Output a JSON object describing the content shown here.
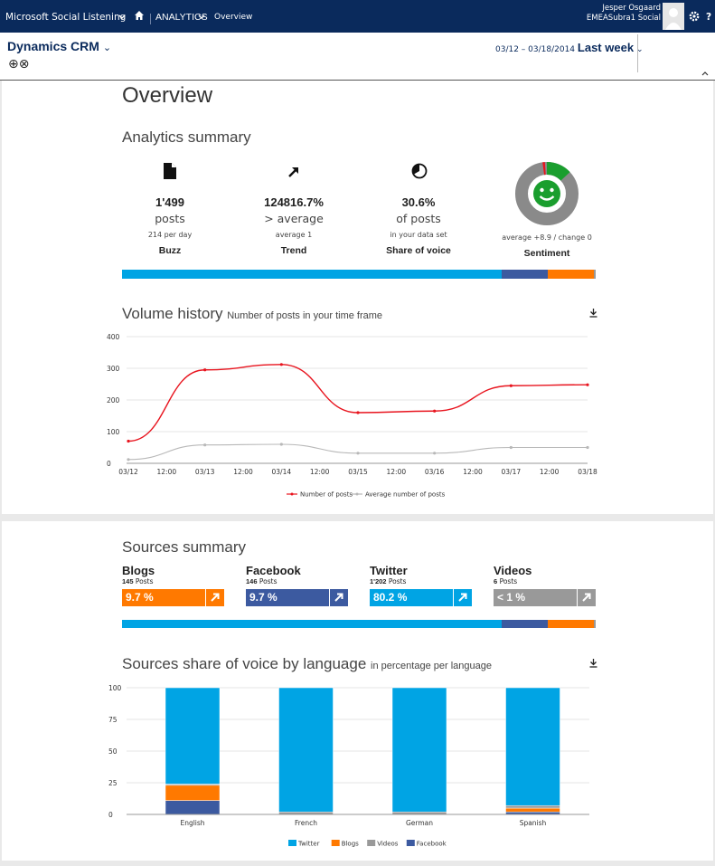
{
  "topbar": {
    "app_title": "Microsoft Social Listening",
    "section": "ANALYTICS",
    "page": "Overview",
    "user_name": "Jesper Osgaard",
    "user_org": "EMEASubra1 Social"
  },
  "context": {
    "entity": "Dynamics CRM",
    "date_range": "03/12 – 03/18/2014",
    "period": "Last week"
  },
  "page_title": "Overview",
  "analytics_summary": {
    "heading": "Analytics summary",
    "stats": [
      {
        "icon": "document-icon",
        "value": "1'499",
        "unit": "posts",
        "sub": "214 per day",
        "label": "Buzz"
      },
      {
        "icon": "trend-arrow-icon",
        "value": "124816.7%",
        "unit": "> average",
        "sub": "average 1",
        "label": "Trend"
      },
      {
        "icon": "share-pie-icon",
        "value": "30.6%",
        "unit": "of posts",
        "sub": "in your data set",
        "label": "Share of voice"
      },
      {
        "icon": "smiley-icon",
        "value": "",
        "unit": "",
        "sub": "average +8.9 / change 0",
        "label": "Sentiment"
      }
    ],
    "sentiment_shares": {
      "positive": 0.13,
      "neutral": 0.85,
      "negative": 0.02
    }
  },
  "share_bar": [
    {
      "name": "Twitter",
      "share": 0.802,
      "color": "#00a4e4"
    },
    {
      "name": "Facebook",
      "share": 0.097,
      "color": "#3c5aa0"
    },
    {
      "name": "Blogs",
      "share": 0.097,
      "color": "#ff7900"
    },
    {
      "name": "Videos",
      "share": 0.004,
      "color": "#999999"
    }
  ],
  "volume_history": {
    "heading": "Volume history",
    "subheading": "Number of posts in your time frame",
    "download_icon": "download-icon"
  },
  "sources_summary": {
    "heading": "Sources summary",
    "sources": [
      {
        "name": "Blogs",
        "count": "145",
        "count_label": "Posts",
        "share": "9.7 %",
        "color": "#ff7900"
      },
      {
        "name": "Facebook",
        "count": "146",
        "count_label": "Posts",
        "share": "9.7 %",
        "color": "#3c5aa0"
      },
      {
        "name": "Twitter",
        "count": "1'202",
        "count_label": "Posts",
        "share": "80.2 %",
        "color": "#00a4e4"
      },
      {
        "name": "Videos",
        "count": "6",
        "count_label": "Posts",
        "share": "< 1 %",
        "color": "#999999"
      }
    ]
  },
  "language_share": {
    "heading": "Sources share of voice by language",
    "subheading": "in percentage per language",
    "download_icon": "download-icon"
  },
  "chart_data": [
    {
      "type": "line",
      "title": "Volume history",
      "subtitle": "Number of posts in your time frame",
      "x": [
        "03/12",
        "03/13",
        "03/14",
        "03/15",
        "03/16",
        "03/17",
        "03/18"
      ],
      "x_tick_labels": [
        "03/12",
        "12:00",
        "03/13",
        "12:00",
        "03/14",
        "12:00",
        "03/15",
        "12:00",
        "03/16",
        "12:00",
        "03/17",
        "12:00",
        "03/18"
      ],
      "y_ticks": [
        0,
        100,
        200,
        300,
        400
      ],
      "ylim": [
        0,
        400
      ],
      "grid": true,
      "legend": "bottom",
      "series": [
        {
          "name": "Number of posts",
          "color": "#e8141e",
          "values": [
            70,
            295,
            312,
            160,
            165,
            245,
            248
          ]
        },
        {
          "name": "Average number of posts",
          "color": "#b8b8b8",
          "values": [
            12,
            58,
            60,
            32,
            32,
            50,
            50
          ]
        }
      ]
    },
    {
      "type": "bar",
      "stacked": true,
      "title": "Sources share of voice by language",
      "subtitle": "in percentage per language",
      "categories": [
        "English",
        "French",
        "German",
        "Spanish"
      ],
      "y_ticks": [
        0,
        25,
        50,
        75,
        100
      ],
      "ylim": [
        0,
        100
      ],
      "grid": true,
      "legend": "bottom",
      "series": [
        {
          "name": "Facebook",
          "color": "#3c5aa0",
          "values": [
            11,
            0,
            0,
            2
          ]
        },
        {
          "name": "Blogs",
          "color": "#ff7900",
          "values": [
            12,
            0,
            0,
            3
          ]
        },
        {
          "name": "Videos",
          "color": "#999999",
          "values": [
            1,
            2,
            2,
            2
          ]
        },
        {
          "name": "Twitter",
          "color": "#00a4e4",
          "values": [
            76,
            98,
            98,
            93
          ]
        }
      ]
    }
  ]
}
